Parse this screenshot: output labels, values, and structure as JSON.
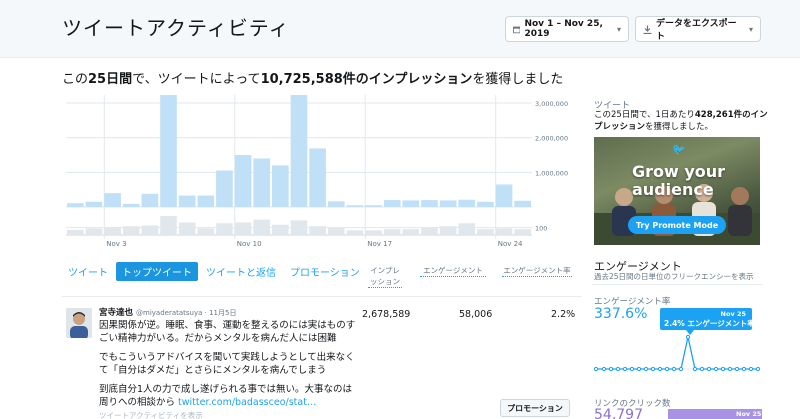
{
  "header": {
    "title": "ツイートアクティビティ",
    "date_range": "Nov 1 – Nov 25, 2019",
    "export_label": "データをエクスポート",
    "calendar_icon": "calendar-icon",
    "download_icon": "download-icon"
  },
  "summary": {
    "prefix": "この",
    "days": "25日間",
    "middle": "で、ツイートによって",
    "impressions": "10,725,588件のインプレッション",
    "suffix": "を獲得しました"
  },
  "chart_data": {
    "type": "bar",
    "series": [
      {
        "values": [
          110000,
          150000,
          400000,
          90000,
          380000,
          3750000,
          330000,
          330000,
          1050000,
          1500000,
          1400000,
          1200000,
          3840000,
          1690000,
          160000,
          50000,
          50000,
          200000,
          190000,
          200000,
          190000,
          210000,
          150000,
          650000,
          180000
        ]
      },
      {
        "values": [
          70,
          90,
          110,
          120,
          130,
          260,
          170,
          90,
          160,
          170,
          210,
          140,
          200,
          120,
          100,
          65,
          65,
          80,
          80,
          100,
          120,
          160,
          80,
          90,
          80
        ]
      }
    ],
    "ticks_top": [
      "3,000,000",
      "2,000,000",
      "1,000,000"
    ],
    "tick_bottom": "100",
    "x_ticks": [
      "Nov 3",
      "Nov 10",
      "Nov 17",
      "Nov 24"
    ]
  },
  "side": {
    "tweets_label": "ツイート",
    "tweets_desc_prefix": "この25日間で、1日あたり",
    "tweets_desc_bold": "428,261件のインプレッション",
    "tweets_desc_suffix": "を獲得しました。",
    "promo_title": "Grow your audience",
    "promo_button": "Try Promote Mode",
    "engagement_title": "エンゲージメント",
    "engagement_sub": "過去25日間の日単位のフリークエンシーを表示",
    "er_label": "エンゲージメント率",
    "er_value": "337.6%",
    "er_tooltip_date": "Nov 25",
    "er_tooltip_text": "2.4% エンゲージメント率",
    "link_label": "リンクのクリック数",
    "link_value": "54,797",
    "link_date": "Nov 25"
  },
  "tabs": [
    "ツイート",
    "トップツイート",
    "ツイートと返信",
    "プロモーション"
  ],
  "columns": {
    "impressions": [
      "インプレ",
      "ッション"
    ],
    "engagements": "エンゲージメント",
    "engagement_rate": "エンゲージメント率"
  },
  "tweet": {
    "name": "宮寺達也",
    "handle": "@miyaderatatsuya · 11月5日",
    "p1": "因果関係が逆。睡眠、食事、運動を整えるのには実はものすごい精神力がいる。だからメンタルを病んだ人には困難",
    "p2": "でもこういうアドバイスを聞いて実践しようとして出来なくて「自分はダメだ」とさらにメンタルを病んでしまう",
    "p3": "到底自分1人の力で成し遂げられる事では無い。大事なのは周りへの相談から",
    "link": "twitter.com/badassceo/stat…",
    "footer": "ツイートアクティビティを表示",
    "impressions": "2,678,589",
    "engagements": "58,006",
    "rate": "2.2%",
    "promote": "プロモーション"
  }
}
